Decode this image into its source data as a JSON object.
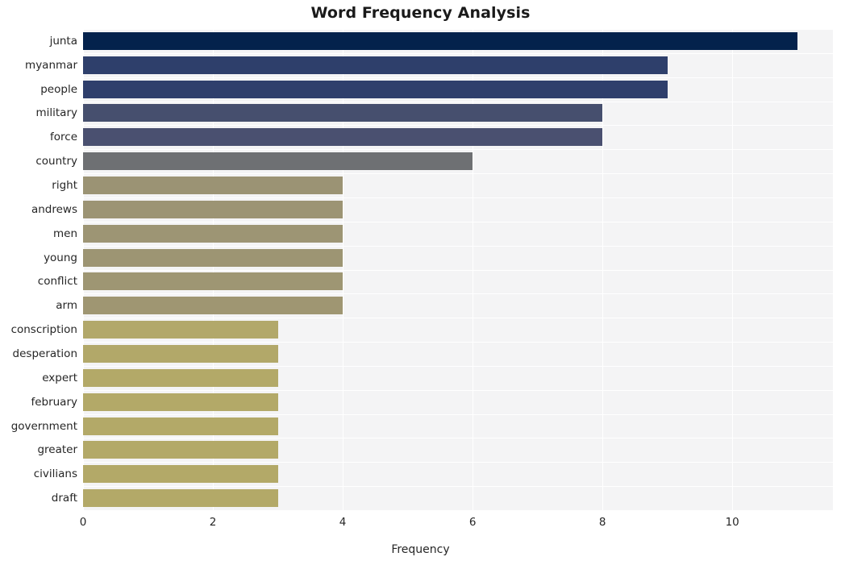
{
  "chart_data": {
    "type": "bar",
    "orientation": "horizontal",
    "title": "Word Frequency Analysis",
    "xlabel": "Frequency",
    "ylabel": "",
    "xlim": [
      0,
      11.55
    ],
    "grid": true,
    "legend": "none",
    "xticks": [
      "0",
      "2",
      "4",
      "6",
      "8",
      "10"
    ],
    "xtick_values": [
      0,
      2,
      4,
      6,
      8,
      10
    ],
    "categories": [
      "junta",
      "myanmar",
      "people",
      "military",
      "force",
      "country",
      "right",
      "andrews",
      "men",
      "young",
      "conflict",
      "arm",
      "conscription",
      "desperation",
      "expert",
      "february",
      "government",
      "greater",
      "civilians",
      "draft"
    ],
    "values": [
      11,
      9,
      9,
      8,
      8,
      6,
      4,
      4,
      4,
      4,
      4,
      4,
      3,
      3,
      3,
      3,
      3,
      3,
      3,
      3
    ],
    "bar_colors": [
      "#04224c",
      "#2e3f6b",
      "#2f3f6c",
      "#464f6e",
      "#4a5070",
      "#6e7073",
      "#9b9374",
      "#9c9474",
      "#9d9574",
      "#9d9573",
      "#9e9673",
      "#9f9672",
      "#b2a86a",
      "#b2a869",
      "#b3a968",
      "#b3a968",
      "#b3a968",
      "#b3a968",
      "#b3a968",
      "#b3a968"
    ],
    "plot_background": "#f4f4f5",
    "gridline_color": "#ffffff",
    "text_color": "#262626"
  }
}
